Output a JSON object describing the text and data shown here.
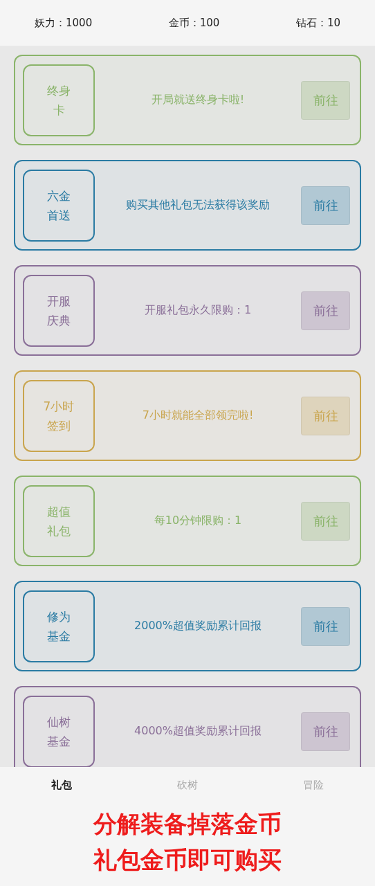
{
  "stats": [
    {
      "label": "妖力：1000"
    },
    {
      "label": "金币：100"
    },
    {
      "label": "钻石：10"
    }
  ],
  "packs": [
    {
      "title": "终身卡",
      "description": "开局就送终身卡啦!",
      "button": "前往",
      "color": "#8ab46a"
    },
    {
      "title": "六金首送",
      "description": "购买其他礼包无法获得该奖励",
      "button": "前往",
      "color": "#2a7ba3"
    },
    {
      "title": "开服庆典",
      "description": "开服礼包永久限购：1",
      "button": "前往",
      "color": "#8a6f98"
    },
    {
      "title": "7小时签到",
      "description": "7小时就能全部领完啦!",
      "button": "前往",
      "color": "#c9a54e"
    },
    {
      "title": "超值礼包",
      "description": "每10分钟限购：1",
      "button": "前往",
      "color": "#8ab46a"
    },
    {
      "title": "修为基金",
      "description": "2000%超值奖励累计回报",
      "button": "前往",
      "color": "#2a7ba3"
    },
    {
      "title": "仙树基金",
      "description": "4000%超值奖励累计回报",
      "button": "前往",
      "color": "#8a6f98"
    }
  ],
  "tabs": [
    {
      "label": "礼包",
      "selected": true
    },
    {
      "label": "砍树",
      "selected": false
    },
    {
      "label": "冒险",
      "selected": false
    }
  ],
  "caption": [
    "分解装备掉落金币",
    "礼包金币即可购买"
  ]
}
